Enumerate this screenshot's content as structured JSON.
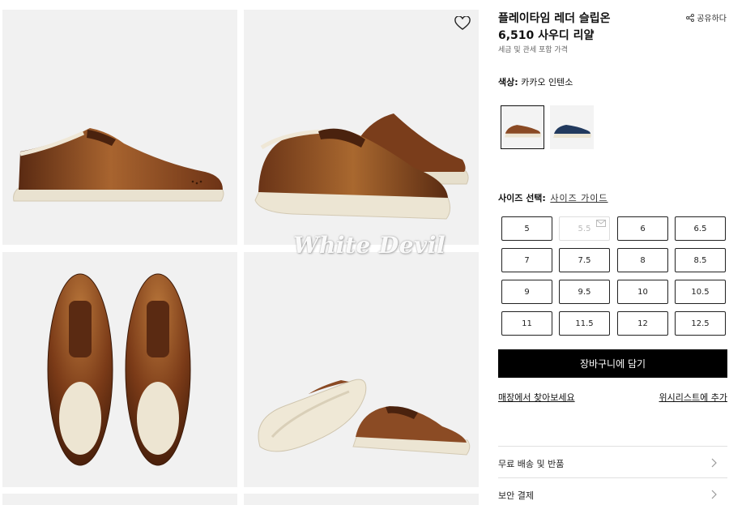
{
  "product": {
    "title": "플레이타임 레더 슬립온",
    "price": "6,510 사우디 리얄",
    "tax_note": "세금 및 관세 포함 가격",
    "share_label": "공유하다"
  },
  "color": {
    "label": "색상:",
    "value": "카카오 인텐소",
    "swatches": [
      {
        "name": "brown",
        "color": "#8a4a24"
      },
      {
        "name": "navy",
        "color": "#223a5e"
      }
    ]
  },
  "size": {
    "label": "사이즈 선택:",
    "guide_label": "사이즈 가이드",
    "options": [
      "5",
      "5.5",
      "6",
      "6.5",
      "7",
      "7.5",
      "8",
      "8.5",
      "9",
      "9.5",
      "10",
      "10.5",
      "11",
      "11.5",
      "12",
      "12.5"
    ],
    "unavailable": [
      "5.5"
    ]
  },
  "actions": {
    "cart_label": "장바구니에 담기",
    "store_link": "매장에서 찾아보세요",
    "wishlist_link": "위시리스트에 추가"
  },
  "accordion": [
    {
      "label": "무료 배송 및 반품"
    },
    {
      "label": "보안 결제"
    }
  ],
  "watermark": "White Devil",
  "colors": {
    "leather": "#8b4b24",
    "sole": "#ede6d6",
    "button": "#000000"
  },
  "icons": [
    "heart-icon",
    "share-icon",
    "mail-icon",
    "chevron-right-icon"
  ]
}
